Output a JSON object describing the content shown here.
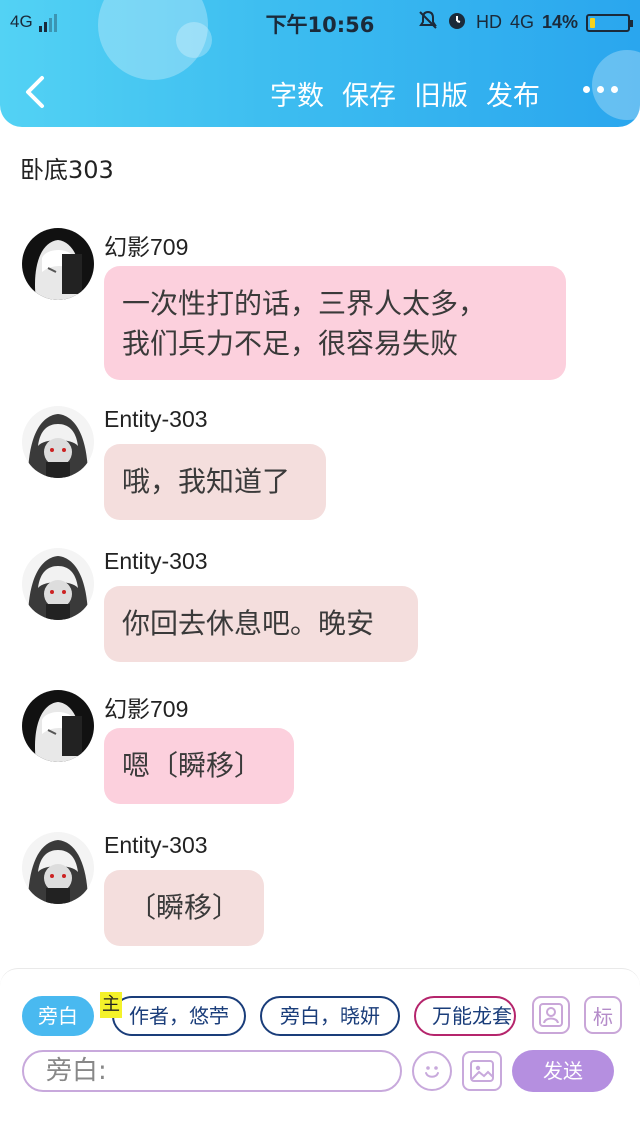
{
  "status_bar": {
    "network": "4G",
    "time": "下午10:56",
    "hd_label": "HD",
    "network_right": "4G",
    "battery_percent": "14%",
    "battery_level": 0.14,
    "battery_color": "#f5d31c"
  },
  "nav": {
    "actions": [
      "字数",
      "保存",
      "旧版",
      "发布"
    ]
  },
  "chat": {
    "title": "卧底303",
    "messages": [
      {
        "sender": "幻影709",
        "avatar": "white-hair-avatar",
        "text": "一次性打的话，三界人太多，\n我们兵力不足，很容易失败",
        "bubble_color": "#fcd0dd"
      },
      {
        "sender": "Entity-303",
        "avatar": "hooded-avatar",
        "text": "哦，我知道了",
        "bubble_color": "#f4dedd"
      },
      {
        "sender": "Entity-303",
        "avatar": "hooded-avatar",
        "text": "你回去休息吧。晚安",
        "bubble_color": "#f4dedd"
      },
      {
        "sender": "幻影709",
        "avatar": "white-hair-avatar",
        "text": "嗯〔瞬移〕",
        "bubble_color": "#fcd0dd"
      },
      {
        "sender": "Entity-303",
        "avatar": "hooded-avatar",
        "text": "〔瞬移〕",
        "bubble_color": "#f4dedd"
      }
    ]
  },
  "roles": {
    "chips": [
      {
        "label": "旁白",
        "style": "active"
      },
      {
        "label": "作者，悠苧",
        "style": "outline-blue",
        "tag": "主"
      },
      {
        "label": "旁白，晓妍",
        "style": "outline-blue"
      },
      {
        "label": "万能龙套",
        "style": "outline-pink"
      }
    ],
    "tag_main": "主",
    "icon_person": "person-card-icon",
    "icon_mark": "标"
  },
  "composer": {
    "value": "旁白:",
    "send_label": "发送",
    "emoji_icon": "emoji-icon",
    "image_icon": "image-icon",
    "accent": "#b58fe0"
  }
}
